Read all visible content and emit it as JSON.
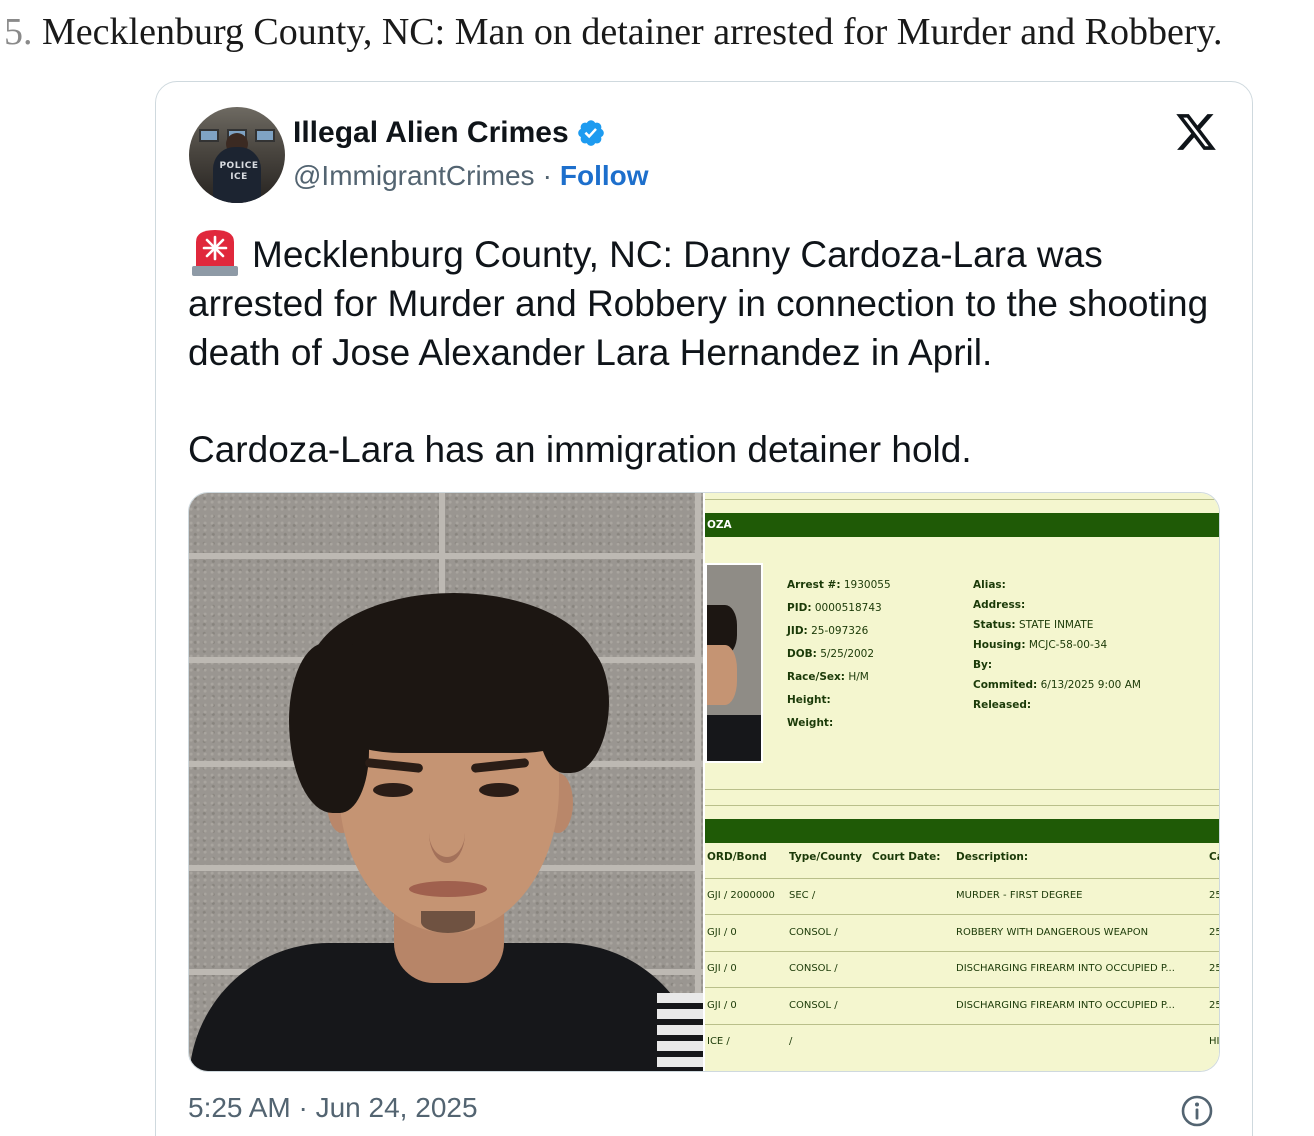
{
  "article": {
    "item_number": "5.",
    "heading": "Mecklenburg County, NC: Man on detainer arrested for Murder and Robbery."
  },
  "tweet": {
    "display_name": "Illegal Alien Crimes",
    "handle": "@ImmigrantCrimes",
    "separator": "·",
    "follow_label": "Follow",
    "avatar_patch_line1": "POLICE",
    "avatar_patch_line2": "ICE",
    "text_paragraph_1": "Mecklenburg County, NC: Danny Cardoza-Lara was arrested for Murder and Robbery in connection to the shooting death of Jose Alexander Lara Hernandez in April.",
    "text_paragraph_2": "Cardoza-Lara has an immigration detainer hold.",
    "timestamp": "5:25 AM · Jun 24, 2025",
    "icons": [
      "verified-badge-icon",
      "x-logo-icon",
      "siren-emoji-icon",
      "info-icon"
    ],
    "accent_color": "#1d6fcc"
  },
  "record": {
    "name_fragment": "OZA",
    "left_fields": [
      {
        "label": "Arrest #:",
        "value": "1930055"
      },
      {
        "label": "PID:",
        "value": "0000518743"
      },
      {
        "label": "JID:",
        "value": "25-097326"
      },
      {
        "label": "DOB:",
        "value": "5/25/2002"
      },
      {
        "label": "Race/Sex:",
        "value": "H/M"
      },
      {
        "label": "Height:",
        "value": ""
      },
      {
        "label": "Weight:",
        "value": ""
      }
    ],
    "right_fields": [
      {
        "label": "Alias:",
        "value": ""
      },
      {
        "label": "Address:",
        "value": ""
      },
      {
        "label": "Status:",
        "value": "STATE INMATE"
      },
      {
        "label": "Housing:",
        "value": "MCJC-58-00-34"
      },
      {
        "label": "By:",
        "value": ""
      },
      {
        "label": "Commited:",
        "value": "6/13/2025 9:00 AM"
      },
      {
        "label": "Released:",
        "value": ""
      }
    ],
    "table_headers": [
      "ORD/Bond",
      "Type/County",
      "Court Date:",
      "Description:",
      "Ca"
    ],
    "rows": [
      {
        "bond": "GJI / 2000000",
        "type": "SEC /",
        "court": "",
        "desc": "MURDER - FIRST DEGREE",
        "ca": "25"
      },
      {
        "bond": "GJI / 0",
        "type": "CONSOL /",
        "court": "",
        "desc": "ROBBERY WITH DANGEROUS WEAPON",
        "ca": "25"
      },
      {
        "bond": "GJI / 0",
        "type": "CONSOL /",
        "court": "",
        "desc": "DISCHARGING FIREARM INTO OCCUPIED P...",
        "ca": "25"
      },
      {
        "bond": "GJI / 0",
        "type": "CONSOL /",
        "court": "",
        "desc": "DISCHARGING FIREARM INTO OCCUPIED P...",
        "ca": "25"
      },
      {
        "bond": "ICE /",
        "type": "/",
        "court": "",
        "desc": "",
        "ca": "HI"
      }
    ]
  }
}
